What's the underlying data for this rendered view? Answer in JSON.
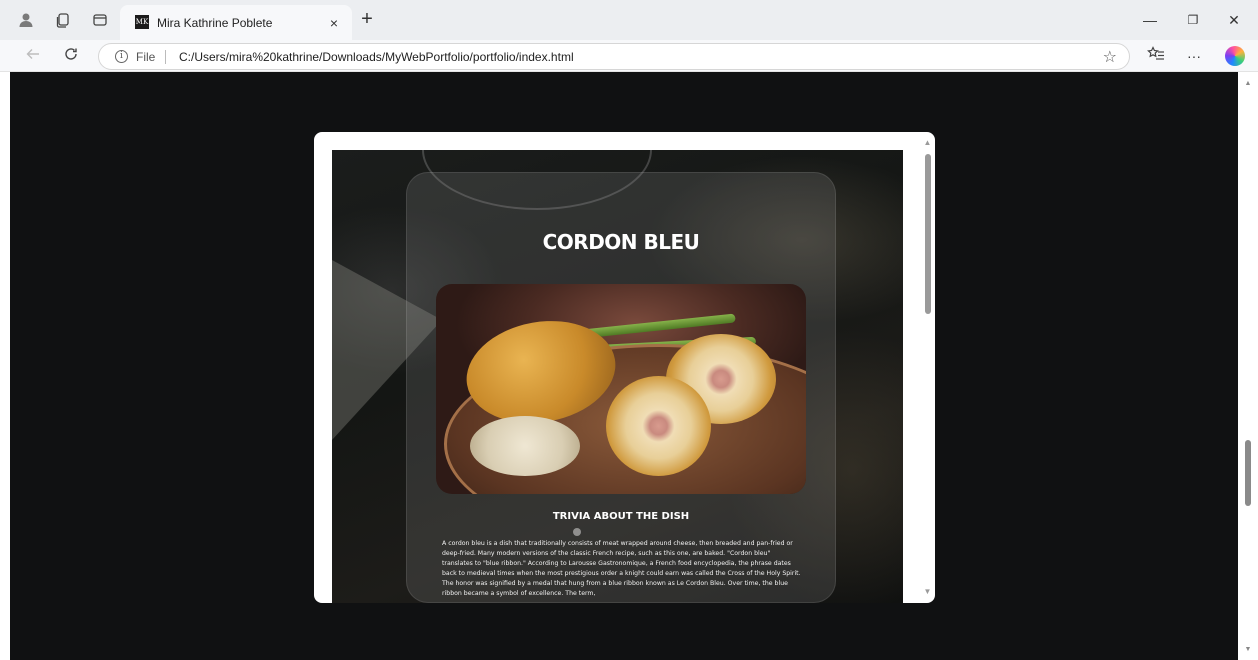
{
  "browser": {
    "tab_title": "Mira Kathrine Poblete",
    "tab_favicon_text": "MK",
    "tab_close": "×",
    "new_tab": "+",
    "address_scheme": "File",
    "address_url": "C:/Users/mira%20kathrine/Downloads/MyWebPortfolio/portfolio/index.html",
    "menu_label": "···",
    "window_controls": {
      "minimize": "—",
      "restore": "❐",
      "close": "✕"
    }
  },
  "icons": {
    "profile": "profile-icon",
    "workspaces": "workspaces-icon",
    "tab_actions": "tab-actions-icon",
    "back": "back-arrow-icon",
    "refresh": "refresh-icon",
    "info": "info-icon",
    "favorite": "star-icon",
    "favorites_list": "favorites-icon",
    "copilot": "copilot-icon"
  },
  "modal": {
    "title": "CORDON BLEU",
    "image_alt": "Cordon bleu plated with asparagus and risotto",
    "trivia_heading": "TRIVIA ABOUT THE DISH",
    "trivia_text": "A cordon bleu is a dish that traditionally consists of meat wrapped around cheese, then breaded and pan-fried or deep-fried. Many modern versions of the classic French recipe, such as this one, are baked. \"Cordon bleu\" translates to \"blue ribbon.\" According to Larousse Gastronomique, a French food encyclopedia, the phrase dates back to medieval times when the most prestigious order a knight could earn was called the Cross of the Holy Spirit. The honor was signified by a medal that hung from a blue ribbon known as Le Cordon Bleu. Over time, the blue ribbon became a symbol of excellence. The term,"
  },
  "colors": {
    "page_background": "#101112",
    "tabstrip": "#eceef1",
    "toolbar": "#f7f8fa"
  }
}
